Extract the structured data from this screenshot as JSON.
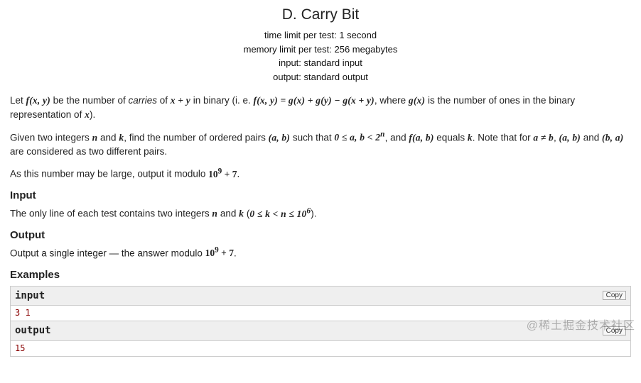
{
  "header": {
    "title": "D. Carry Bit",
    "time_limit": "time limit per test: 1 second",
    "memory_limit": "memory limit per test: 256 megabytes",
    "input": "input: standard input",
    "output": "output: standard output"
  },
  "statement": {
    "p1_prefix": "Let ",
    "p1_fxy": "f(x, y)",
    "p1_mid1": " be the number of ",
    "p1_carries": "carries",
    "p1_mid2": " of ",
    "p1_xpy": "x + y",
    "p1_mid3": " in binary (i. e. ",
    "p1_eq": "f(x, y) = g(x) + g(y) − g(x + y)",
    "p1_mid4": ", where ",
    "p1_gx": "g(x)",
    "p1_mid5": " is the number of ones in the binary representation of ",
    "p1_x": "x",
    "p1_end": ").",
    "p2_prefix": "Given two integers ",
    "p2_n": "n",
    "p2_mid1": " and ",
    "p2_k": "k",
    "p2_mid2": ", find the number of ordered pairs ",
    "p2_ab": "(a, b)",
    "p2_mid3": " such that ",
    "p2_range": "0 ≤ a, b < 2",
    "p2_exp": "n",
    "p2_mid4": ", and ",
    "p2_fab": "f(a, b)",
    "p2_mid5": " equals ",
    "p2_k2": "k",
    "p2_mid6": ". Note that for ",
    "p2_aneb": "a ≠ b",
    "p2_mid7": ", ",
    "p2_ab2": "(a, b)",
    "p2_mid8": " and ",
    "p2_ba": "(b, a)",
    "p2_end": " are considered as two different pairs.",
    "p3_prefix": "As this number may be large, output it modulo ",
    "p3_mod": "10",
    "p3_mod_exp": "9",
    "p3_mod_suffix": " + 7",
    "p3_end": "."
  },
  "input_section": {
    "title": "Input",
    "text_prefix": "The only line of each test contains two integers ",
    "n": "n",
    "mid1": " and ",
    "k": "k",
    "mid2": " (",
    "range": "0 ≤ k < n ≤ 10",
    "range_exp": "6",
    "end": ")."
  },
  "output_section": {
    "title": "Output",
    "text_prefix": "Output a single integer  — the answer modulo ",
    "mod": "10",
    "mod_exp": "9",
    "mod_suffix": " + 7",
    "end": "."
  },
  "examples": {
    "title": "Examples",
    "input_label": "input",
    "output_label": "output",
    "copy_label": "Copy",
    "input_value": "3 1",
    "output_value": "15"
  },
  "watermark": "@稀土掘金技术社区"
}
